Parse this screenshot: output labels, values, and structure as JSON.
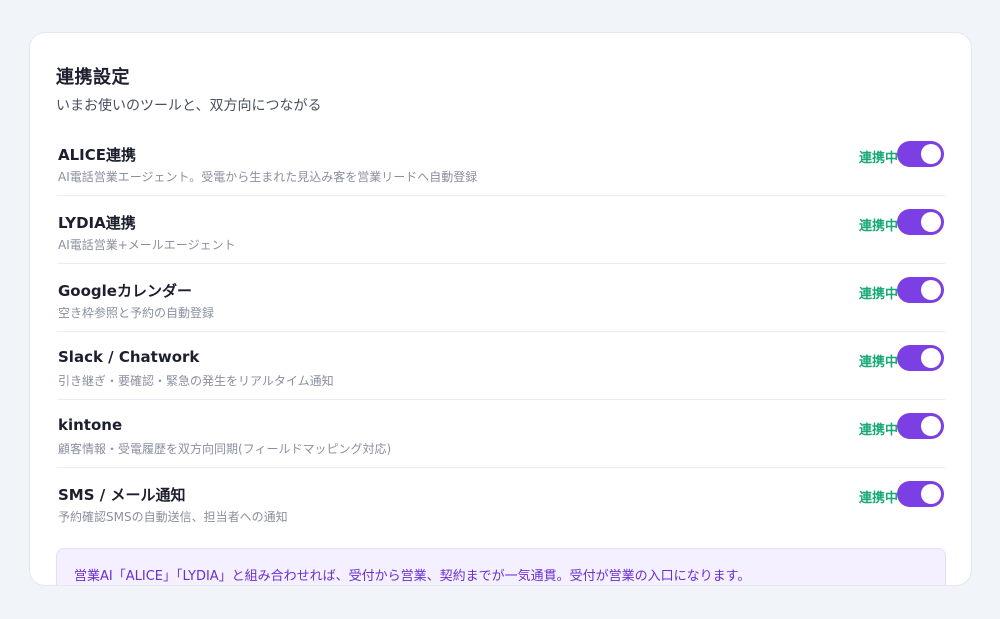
{
  "card": {
    "title": "連携設定",
    "subtitle": "いまお使いのツールと、双方向につながる"
  },
  "integrations": [
    {
      "name": "ALICE連携",
      "description": "AI電話営業エージェント。受電から生まれた見込み客を営業リードへ自動登録",
      "status": "連携中",
      "enabled": true
    },
    {
      "name": "LYDIA連携",
      "description": "AI電話営業+メールエージェント",
      "status": "連携中",
      "enabled": true
    },
    {
      "name": "Googleカレンダー",
      "description": "空き枠参照と予約の自動登録",
      "status": "連携中",
      "enabled": true
    },
    {
      "name": "Slack / Chatwork",
      "description": "引き継ぎ・要確認・緊急の発生をリアルタイム通知",
      "status": "連携中",
      "enabled": true
    },
    {
      "name": "kintone",
      "description": "顧客情報・受電履歴を双方向同期(フィールドマッピング対応)",
      "status": "連携中",
      "enabled": true
    },
    {
      "name": "SMS / メール通知",
      "description": "予約確認SMSの自動送信、担当者への通知",
      "status": "連携中",
      "enabled": true
    }
  ],
  "note": {
    "text": "営業AI「ALICE」「LYDIA」と組み合わせれば、受付から営業、契約までが一気通貫。受付が営業の入口になります。"
  },
  "colors": {
    "toggle_on": "#7b3fe4",
    "status_text": "#19a974",
    "note_bg": "#f4f0ff",
    "note_text": "#6a2fd0"
  }
}
